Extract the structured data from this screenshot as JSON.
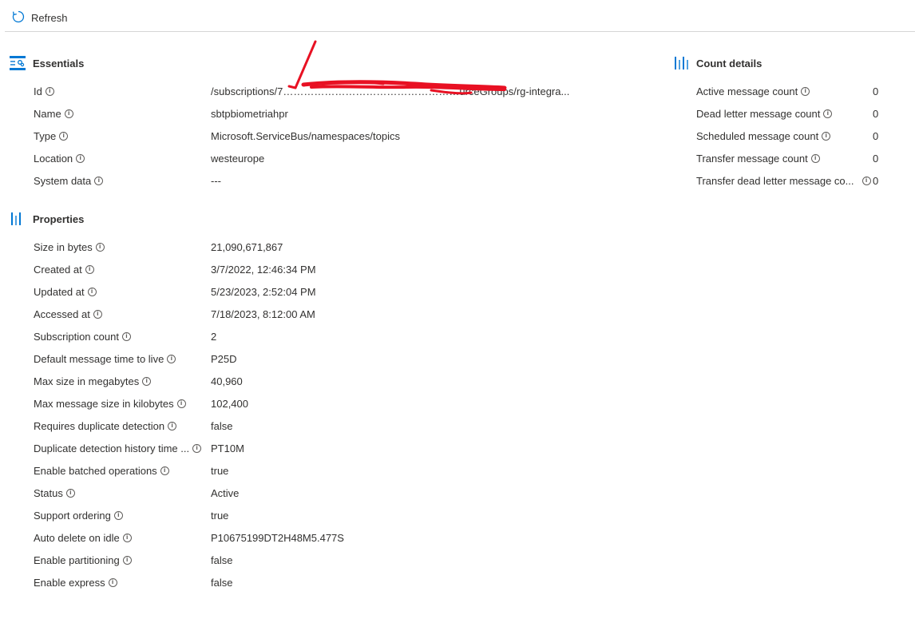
{
  "toolbar": {
    "refresh_label": "Refresh"
  },
  "essentials": {
    "title": "Essentials",
    "rows": [
      {
        "label": "Id",
        "value": "/subscriptions/7……………………………………………urceGroups/rg-integra..."
      },
      {
        "label": "Name",
        "value": "sbtpbiometriahpr"
      },
      {
        "label": "Type",
        "value": "Microsoft.ServiceBus/namespaces/topics"
      },
      {
        "label": "Location",
        "value": "westeurope"
      },
      {
        "label": "System data",
        "value": "---"
      }
    ]
  },
  "count_details": {
    "title": "Count details",
    "rows": [
      {
        "label": "Active message count",
        "value": "0"
      },
      {
        "label": "Dead letter message count",
        "value": "0"
      },
      {
        "label": "Scheduled message count",
        "value": "0"
      },
      {
        "label": "Transfer message count",
        "value": "0"
      },
      {
        "label": "Transfer dead letter message co...",
        "value": "0"
      }
    ]
  },
  "properties": {
    "title": "Properties",
    "rows": [
      {
        "label": "Size in bytes",
        "value": "21,090,671,867"
      },
      {
        "label": "Created at",
        "value": "3/7/2022, 12:46:34 PM"
      },
      {
        "label": "Updated at",
        "value": "5/23/2023, 2:52:04 PM"
      },
      {
        "label": "Accessed at",
        "value": "7/18/2023, 8:12:00 AM"
      },
      {
        "label": "Subscription count",
        "value": "2"
      },
      {
        "label": "Default message time to live",
        "value": "P25D"
      },
      {
        "label": "Max size in megabytes",
        "value": "40,960"
      },
      {
        "label": "Max message size in kilobytes",
        "value": "102,400"
      },
      {
        "label": "Requires duplicate detection",
        "value": "false"
      },
      {
        "label": "Duplicate detection history time ...",
        "value": "PT10M"
      },
      {
        "label": "Enable batched operations",
        "value": "true"
      },
      {
        "label": "Status",
        "value": "Active"
      },
      {
        "label": "Support ordering",
        "value": "true"
      },
      {
        "label": "Auto delete on idle",
        "value": "P10675199DT2H48M5.477S"
      },
      {
        "label": "Enable partitioning",
        "value": "false"
      },
      {
        "label": "Enable express",
        "value": "false"
      }
    ]
  },
  "colors": {
    "accent": "#0078d4",
    "redaction": "#e81123",
    "text": "#323130"
  },
  "icons": {
    "refresh": "refresh-icon",
    "essentials": "essentials-icon",
    "properties": "properties-icon",
    "count": "count-details-icon",
    "info": "info-icon"
  }
}
